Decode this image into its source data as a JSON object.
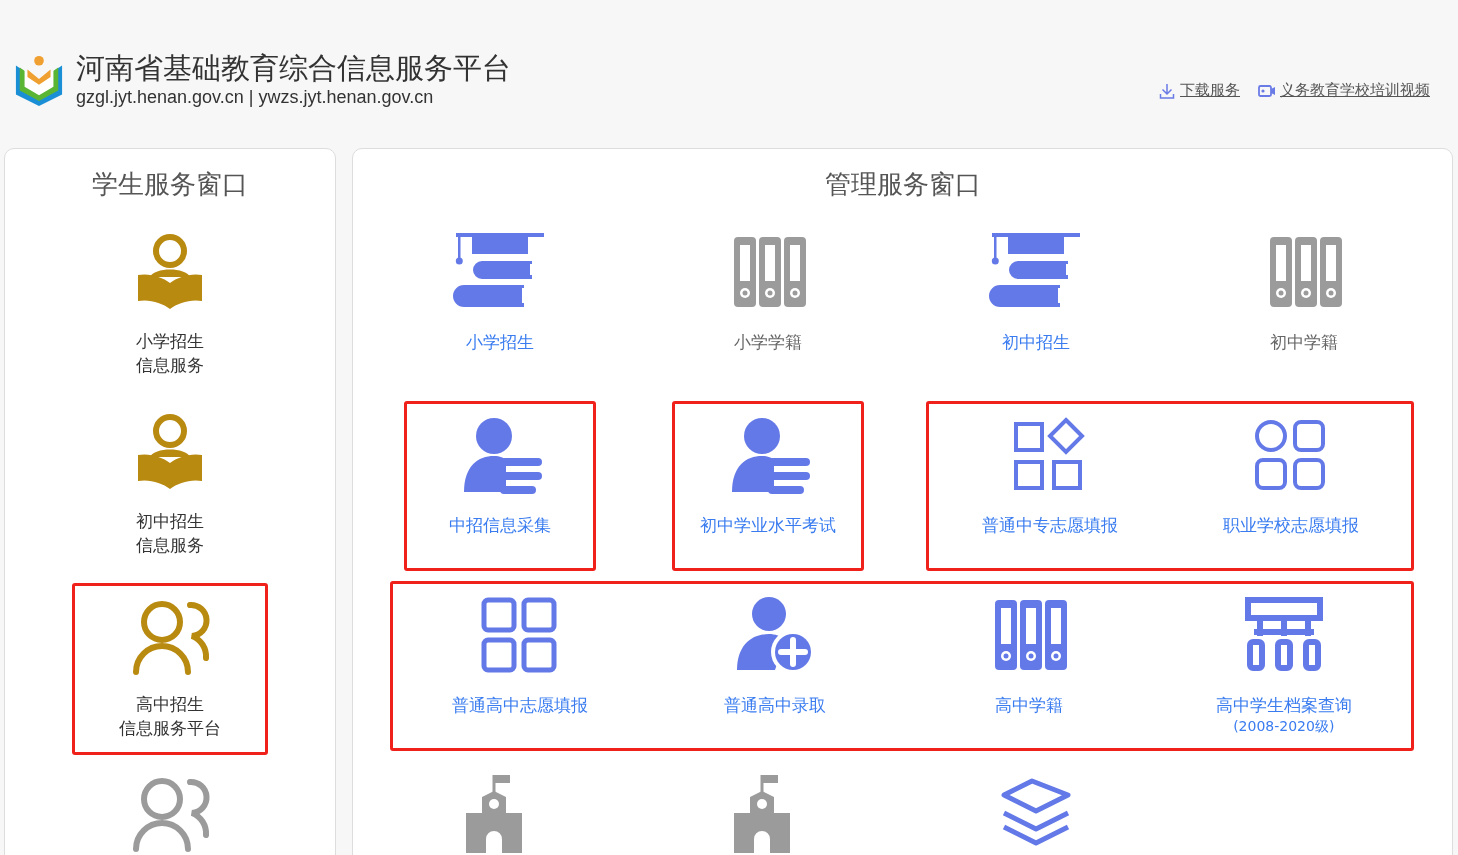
{
  "header": {
    "title": "河南省基础教育综合信息服务平台",
    "domains": "gzgl.jyt.henan.gov.cn | ywzs.jyt.henan.gov.cn",
    "links": [
      {
        "kind": "download",
        "label": "下载服务"
      },
      {
        "kind": "video",
        "label": "义务教育学校培训视频"
      }
    ]
  },
  "student_panel": {
    "title": "学生服务窗口",
    "items": [
      {
        "kind": "reader",
        "enabled": true,
        "highlighted": false,
        "lines": [
          "小学招生",
          "信息服务"
        ]
      },
      {
        "kind": "reader",
        "enabled": true,
        "highlighted": false,
        "lines": [
          "初中招生",
          "信息服务"
        ]
      },
      {
        "kind": "users",
        "enabled": true,
        "highlighted": true,
        "lines": [
          "高中招生",
          "信息服务平台"
        ]
      },
      {
        "kind": "users",
        "enabled": false,
        "highlighted": false
      }
    ]
  },
  "management_panel": {
    "title": "管理服务窗口",
    "rows": [
      {
        "groups": [
          {
            "highlighted": false,
            "items": [
              {
                "kind": "cap-books",
                "enabled": true,
                "label": "小学招生"
              }
            ]
          },
          {
            "highlighted": false,
            "items": [
              {
                "kind": "binders",
                "enabled": false,
                "label": "小学学籍"
              }
            ]
          },
          {
            "highlighted": false,
            "items": [
              {
                "kind": "cap-books",
                "enabled": true,
                "label": "初中招生"
              }
            ]
          },
          {
            "highlighted": false,
            "items": [
              {
                "kind": "binders",
                "enabled": false,
                "label": "初中学籍"
              }
            ]
          }
        ]
      },
      {
        "groups": [
          {
            "highlighted": true,
            "items": [
              {
                "kind": "user-list",
                "enabled": true,
                "label": "中招信息采集"
              }
            ]
          },
          {
            "highlighted": true,
            "items": [
              {
                "kind": "user-list",
                "enabled": true,
                "label": "初中学业水平考试"
              }
            ]
          },
          {
            "highlighted": true,
            "items": [
              {
                "kind": "shapes",
                "enabled": true,
                "label": "普通中专志愿填报"
              },
              {
                "kind": "circle-squares",
                "enabled": true,
                "label": "职业学校志愿填报"
              }
            ]
          }
        ]
      },
      {
        "groups": [
          {
            "highlighted": true,
            "items": [
              {
                "kind": "squares",
                "enabled": true,
                "label": "普通高中志愿填报"
              },
              {
                "kind": "user-plus",
                "enabled": true,
                "label": "普通高中录取"
              },
              {
                "kind": "binders",
                "enabled": true,
                "label": "高中学籍"
              },
              {
                "kind": "org-chart",
                "enabled": true,
                "label": "高中学生档案查询",
                "note": "(2008-2020级)"
              }
            ]
          }
        ]
      },
      {
        "groups": [
          {
            "highlighted": false,
            "items": [
              {
                "kind": "school",
                "enabled": false
              }
            ]
          },
          {
            "highlighted": false,
            "items": [
              {
                "kind": "school",
                "enabled": false
              }
            ]
          },
          {
            "highlighted": false,
            "items": [
              {
                "kind": "layers",
                "enabled": true
              }
            ]
          }
        ]
      }
    ]
  }
}
